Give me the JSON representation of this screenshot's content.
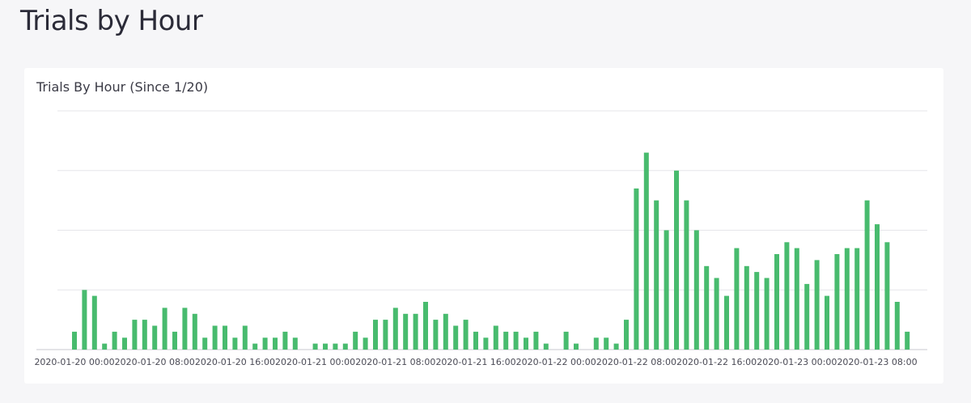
{
  "page": {
    "title": "Trials by Hour"
  },
  "card": {
    "title": "Trials By Hour (Since 1/20)"
  },
  "colors": {
    "bar": "#48bb6e",
    "grid": "#e6e6ea",
    "axis": "#c8c8cf"
  },
  "chart_data": {
    "type": "bar",
    "title": "Trials By Hour (Since 1/20)",
    "xlabel": "",
    "ylabel": "",
    "ylim": [
      0,
      40
    ],
    "grid": true,
    "y_ticks_shown": false,
    "x_start": "2020-01-20 00:00",
    "x_tick_labels": [
      "2020-01-20 00:00",
      "2020-01-20 08:00",
      "2020-01-20 16:00",
      "2020-01-21 00:00",
      "2020-01-21 08:00",
      "2020-01-21 16:00",
      "2020-01-22 00:00",
      "2020-01-22 08:00",
      "2020-01-22 16:00",
      "2020-01-23 00:00",
      "2020-01-23 08:00"
    ],
    "values": [
      3,
      10,
      9,
      1,
      3,
      2,
      5,
      5,
      4,
      7,
      3,
      7,
      6,
      2,
      4,
      4,
      2,
      4,
      1,
      2,
      2,
      3,
      2,
      0,
      1,
      1,
      1,
      1,
      3,
      2,
      5,
      5,
      7,
      6,
      6,
      8,
      5,
      6,
      4,
      5,
      3,
      2,
      4,
      3,
      3,
      2,
      3,
      1,
      0,
      3,
      1,
      0,
      2,
      2,
      1,
      5,
      27,
      33,
      25,
      20,
      30,
      25,
      20,
      14,
      12,
      9,
      17,
      14,
      13,
      12,
      16,
      18,
      17,
      11,
      15,
      9,
      16,
      17,
      17,
      25,
      21,
      18,
      8,
      3
    ]
  }
}
